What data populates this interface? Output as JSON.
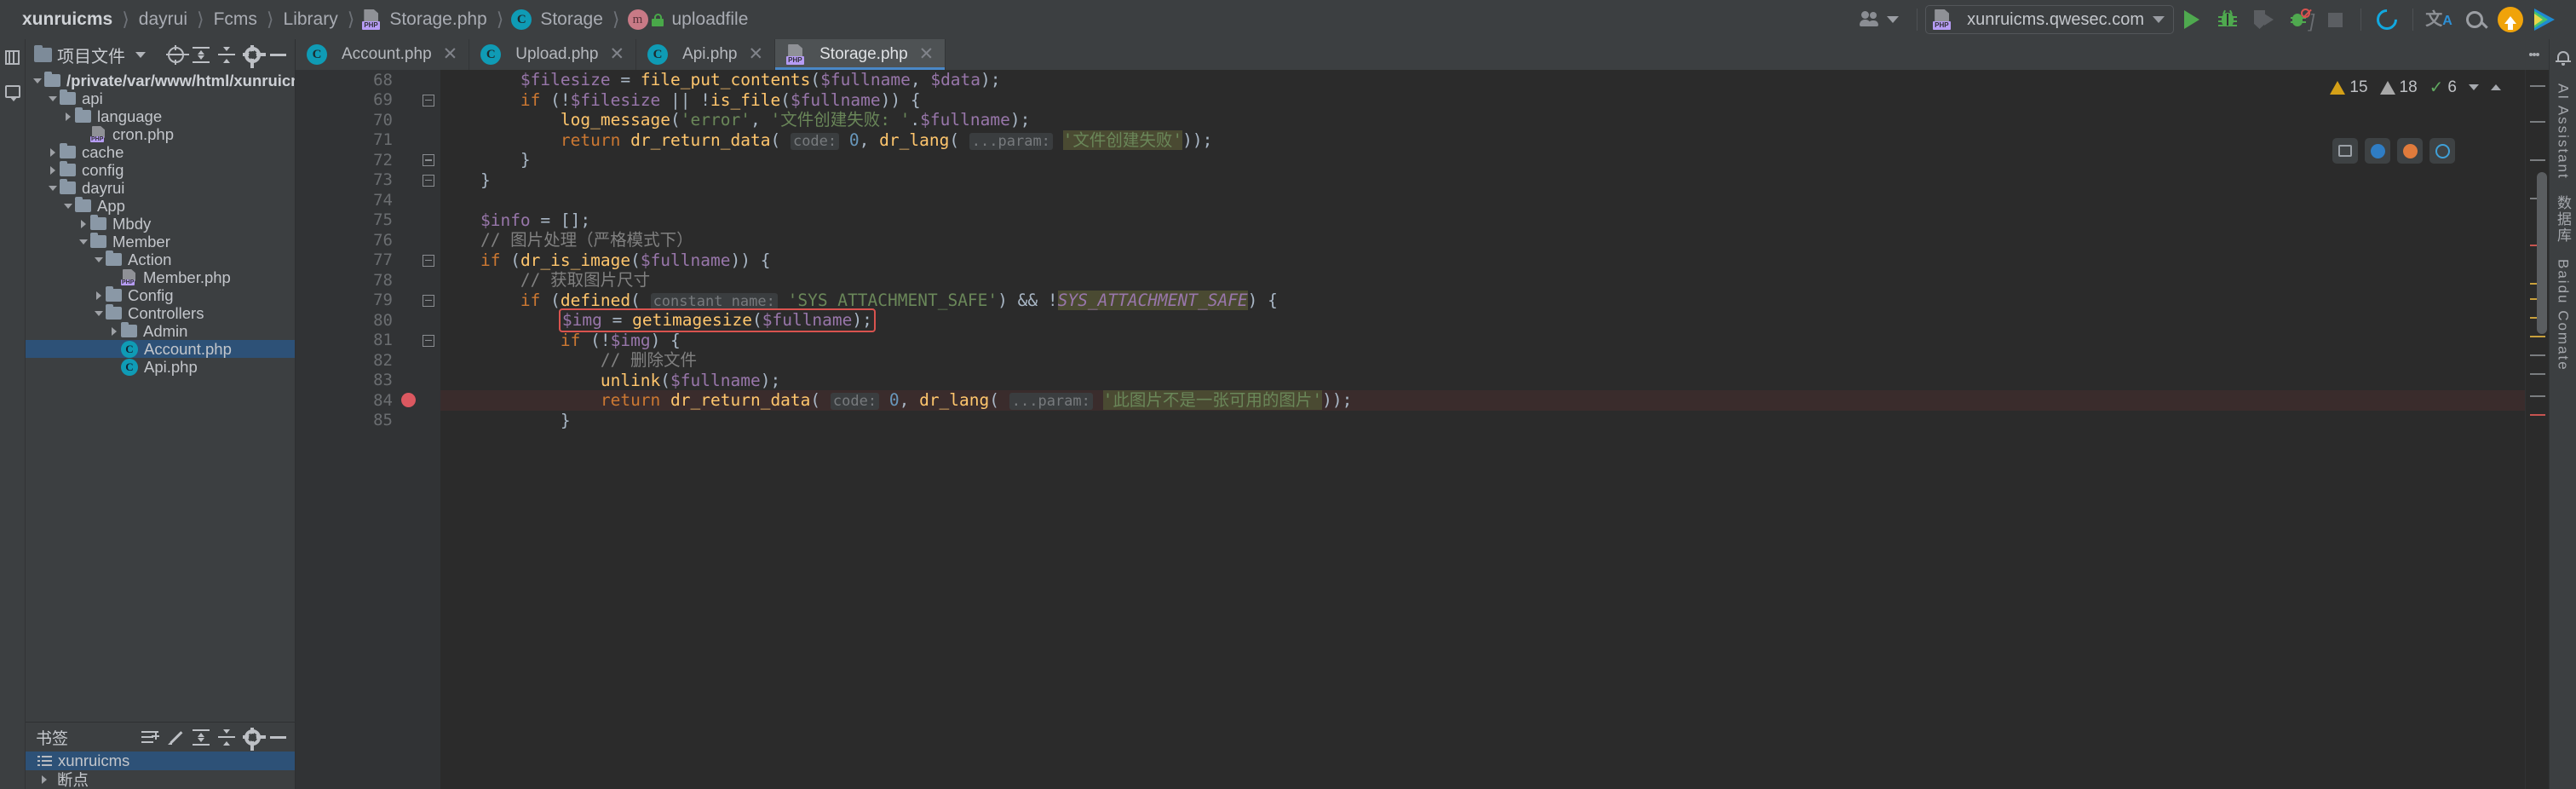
{
  "breadcrumbs": [
    {
      "label": "xunruicms",
      "icon": null,
      "bold": true
    },
    {
      "label": "dayrui",
      "icon": null
    },
    {
      "label": "Fcms",
      "icon": null
    },
    {
      "label": "Library",
      "icon": null
    },
    {
      "label": "Storage.php",
      "icon": "php-file-icon"
    },
    {
      "label": "Storage",
      "icon": "class-icon"
    },
    {
      "label": "uploadfile",
      "icon": "method-icon"
    }
  ],
  "topbar": {
    "run_config": "xunruicms.qwesec.com",
    "icons": [
      "user-avatar-icon",
      "chevron-down-icon",
      "run-icon",
      "debug-icon",
      "coverage-icon",
      "profiler-icon",
      "stop-icon",
      "update-icon",
      "translate-icon",
      "search-everywhere-icon",
      "update-badge-icon",
      "ai-assistant-icon"
    ]
  },
  "left_rail": {
    "items": [
      {
        "name": "project-tool-window",
        "label": "项目"
      },
      {
        "name": "commit-tool-window",
        "label": ""
      }
    ]
  },
  "project_panel": {
    "title": "项目文件",
    "toolbar": [
      "locate-icon",
      "expand-all-icon",
      "collapse-all-icon",
      "settings-icon",
      "hide-icon"
    ],
    "tree": [
      {
        "indent": 0,
        "arrow": "down",
        "icon": "folder",
        "label": "/private/var/www/html/xunruicms",
        "root": true
      },
      {
        "indent": 1,
        "arrow": "down",
        "icon": "folder",
        "label": "api"
      },
      {
        "indent": 2,
        "arrow": "right",
        "icon": "folder",
        "label": "language"
      },
      {
        "indent": 3,
        "arrow": "none",
        "icon": "php",
        "label": "cron.php"
      },
      {
        "indent": 1,
        "arrow": "right",
        "icon": "folder",
        "label": "cache"
      },
      {
        "indent": 1,
        "arrow": "right",
        "icon": "folder",
        "label": "config"
      },
      {
        "indent": 1,
        "arrow": "down",
        "icon": "folder",
        "label": "dayrui"
      },
      {
        "indent": 2,
        "arrow": "down",
        "icon": "folder",
        "label": "App"
      },
      {
        "indent": 3,
        "arrow": "right",
        "icon": "folder",
        "label": "Mbdy"
      },
      {
        "indent": 3,
        "arrow": "down",
        "icon": "folder",
        "label": "Member"
      },
      {
        "indent": 4,
        "arrow": "down",
        "icon": "folder",
        "label": "Action"
      },
      {
        "indent": 5,
        "arrow": "none",
        "icon": "php",
        "label": "Member.php"
      },
      {
        "indent": 4,
        "arrow": "right",
        "icon": "folder",
        "label": "Config"
      },
      {
        "indent": 4,
        "arrow": "down",
        "icon": "folder",
        "label": "Controllers"
      },
      {
        "indent": 5,
        "arrow": "right",
        "icon": "folder",
        "label": "Admin"
      },
      {
        "indent": 5,
        "arrow": "none",
        "icon": "class",
        "label": "Account.php",
        "selected": true
      },
      {
        "indent": 5,
        "arrow": "none",
        "icon": "class",
        "label": "Api.php"
      }
    ]
  },
  "bookmarks": {
    "title": "书签",
    "toolbar": [
      "add-bookmark-icon",
      "edit-icon",
      "expand-all-icon",
      "collapse-all-icon",
      "settings-icon",
      "hide-icon"
    ],
    "items": [
      {
        "label": "xunruicms",
        "icon": "list-icon",
        "selected": true
      },
      {
        "label": "断点",
        "icon": "none",
        "arrow": "right"
      }
    ]
  },
  "tabs": [
    {
      "label": "Account.php",
      "icon": "class-icon",
      "active": false,
      "closable": true
    },
    {
      "label": "Upload.php",
      "icon": "class-icon",
      "active": false,
      "closable": true
    },
    {
      "label": "Api.php",
      "icon": "class-icon",
      "active": false,
      "closable": true
    },
    {
      "label": "Storage.php",
      "icon": "php-file-icon",
      "active": true,
      "closable": true
    }
  ],
  "inspection": {
    "warnings_count": "15",
    "weak_warnings_count": "18",
    "checked_count": "6",
    "warning_icon": "warning-triangle-icon",
    "weak_warning_icon": "weak-warning-triangle-icon",
    "ok_icon": "checkmark-icon"
  },
  "editor": {
    "first_line": 68,
    "lines": [
      {
        "n": 68,
        "fold": null,
        "break": false,
        "hl": false,
        "tokens": [
          {
            "t": "        ",
            "c": "t-def"
          },
          {
            "t": "$filesize",
            "c": "t-var"
          },
          {
            "t": " = ",
            "c": "t-def"
          },
          {
            "t": "file_put_contents",
            "c": "t-fn"
          },
          {
            "t": "(",
            "c": "t-def"
          },
          {
            "t": "$fullname",
            "c": "t-var"
          },
          {
            "t": ", ",
            "c": "t-def"
          },
          {
            "t": "$data",
            "c": "t-var"
          },
          {
            "t": ");",
            "c": "t-def"
          }
        ]
      },
      {
        "n": 69,
        "fold": "minus",
        "break": false,
        "hl": false,
        "tokens": [
          {
            "t": "        ",
            "c": "t-def"
          },
          {
            "t": "if",
            "c": "t-kw"
          },
          {
            "t": " (!",
            "c": "t-def"
          },
          {
            "t": "$filesize",
            "c": "t-var"
          },
          {
            "t": " || !",
            "c": "t-def"
          },
          {
            "t": "is_file",
            "c": "t-fn"
          },
          {
            "t": "(",
            "c": "t-def"
          },
          {
            "t": "$fullname",
            "c": "t-var"
          },
          {
            "t": ")) {",
            "c": "t-def"
          }
        ]
      },
      {
        "n": 70,
        "fold": null,
        "break": false,
        "hl": false,
        "tokens": [
          {
            "t": "            ",
            "c": "t-def"
          },
          {
            "t": "log_message",
            "c": "t-fn"
          },
          {
            "t": "(",
            "c": "t-def"
          },
          {
            "t": "'error'",
            "c": "t-str"
          },
          {
            "t": ", ",
            "c": "t-def"
          },
          {
            "t": "'文件创建失败: '",
            "c": "t-str"
          },
          {
            "t": ".",
            "c": "t-def"
          },
          {
            "t": "$fullname",
            "c": "t-var"
          },
          {
            "t": ");",
            "c": "t-def"
          }
        ]
      },
      {
        "n": 71,
        "fold": null,
        "break": false,
        "hl": false,
        "tokens": [
          {
            "t": "            ",
            "c": "t-def"
          },
          {
            "t": "return",
            "c": "t-kw"
          },
          {
            "t": " ",
            "c": "t-def"
          },
          {
            "t": "dr_return_data",
            "c": "t-fn"
          },
          {
            "t": "( ",
            "c": "t-def"
          },
          {
            "t": "code:",
            "c": "t-hint"
          },
          {
            "t": " ",
            "c": "t-def"
          },
          {
            "t": "0",
            "c": "t-num"
          },
          {
            "t": ", ",
            "c": "t-def"
          },
          {
            "t": "dr_lang",
            "c": "t-fn"
          },
          {
            "t": "( ",
            "c": "t-def"
          },
          {
            "t": "...param:",
            "c": "t-hint"
          },
          {
            "t": " ",
            "c": "t-def"
          },
          {
            "t": "'文件创建失败'",
            "c": "t-hlstr t-str"
          },
          {
            "t": "));",
            "c": "t-def"
          }
        ]
      },
      {
        "n": 72,
        "fold": "minus",
        "break": false,
        "hl": false,
        "tokens": [
          {
            "t": "        }",
            "c": "t-def"
          }
        ]
      },
      {
        "n": 73,
        "fold": "minus",
        "break": false,
        "hl": false,
        "tokens": [
          {
            "t": "    }",
            "c": "t-def"
          }
        ]
      },
      {
        "n": 74,
        "fold": null,
        "break": false,
        "hl": false,
        "tokens": []
      },
      {
        "n": 75,
        "fold": null,
        "break": false,
        "hl": false,
        "tokens": [
          {
            "t": "    ",
            "c": "t-def"
          },
          {
            "t": "$info",
            "c": "t-var"
          },
          {
            "t": " = [];",
            "c": "t-def"
          }
        ]
      },
      {
        "n": 76,
        "fold": null,
        "break": false,
        "hl": false,
        "tokens": [
          {
            "t": "    // 图片处理（严格模式下）",
            "c": "t-cmt"
          }
        ]
      },
      {
        "n": 77,
        "fold": "minus",
        "break": false,
        "hl": false,
        "tokens": [
          {
            "t": "    ",
            "c": "t-def"
          },
          {
            "t": "if",
            "c": "t-kw"
          },
          {
            "t": " (",
            "c": "t-def"
          },
          {
            "t": "dr_is_image",
            "c": "t-fn"
          },
          {
            "t": "(",
            "c": "t-def"
          },
          {
            "t": "$fullname",
            "c": "t-var"
          },
          {
            "t": ")) {",
            "c": "t-def"
          }
        ]
      },
      {
        "n": 78,
        "fold": null,
        "break": false,
        "hl": false,
        "tokens": [
          {
            "t": "        // 获取图片尺寸",
            "c": "t-cmt"
          }
        ]
      },
      {
        "n": 79,
        "fold": "minus",
        "break": false,
        "hl": false,
        "tokens": [
          {
            "t": "        ",
            "c": "t-def"
          },
          {
            "t": "if",
            "c": "t-kw"
          },
          {
            "t": " (",
            "c": "t-def"
          },
          {
            "t": "defined",
            "c": "t-fn"
          },
          {
            "t": "( ",
            "c": "t-def"
          },
          {
            "t": "constant_name:",
            "c": "t-hint"
          },
          {
            "t": " ",
            "c": "t-def"
          },
          {
            "t": "'SYS_ATTACHMENT_SAFE'",
            "c": "t-str"
          },
          {
            "t": ") && !",
            "c": "t-def"
          },
          {
            "t": "SYS_ATTACHMENT_SAFE",
            "c": "t-constbg"
          },
          {
            "t": ") {",
            "c": "t-def"
          }
        ]
      },
      {
        "n": 80,
        "fold": null,
        "break": false,
        "hl": false,
        "boxed": true,
        "tokens": [
          {
            "t": "            ",
            "c": "t-def"
          },
          {
            "t": "$img",
            "c": "t-var"
          },
          {
            "t": " = ",
            "c": "t-def"
          },
          {
            "t": "getimagesize",
            "c": "t-fn"
          },
          {
            "t": "(",
            "c": "t-def"
          },
          {
            "t": "$fullname",
            "c": "t-var"
          },
          {
            "t": ");",
            "c": "t-def"
          }
        ]
      },
      {
        "n": 81,
        "fold": "minus",
        "break": false,
        "hl": false,
        "tokens": [
          {
            "t": "            ",
            "c": "t-def"
          },
          {
            "t": "if",
            "c": "t-kw"
          },
          {
            "t": " (!",
            "c": "t-def"
          },
          {
            "t": "$img",
            "c": "t-var"
          },
          {
            "t": ") {",
            "c": "t-def"
          }
        ]
      },
      {
        "n": 82,
        "fold": null,
        "break": false,
        "hl": false,
        "tokens": [
          {
            "t": "                // 删除文件",
            "c": "t-cmt"
          }
        ]
      },
      {
        "n": 83,
        "fold": null,
        "break": false,
        "hl": false,
        "tokens": [
          {
            "t": "                ",
            "c": "t-def"
          },
          {
            "t": "unlink",
            "c": "t-fn"
          },
          {
            "t": "(",
            "c": "t-def"
          },
          {
            "t": "$fullname",
            "c": "t-var"
          },
          {
            "t": ");",
            "c": "t-def"
          }
        ]
      },
      {
        "n": 84,
        "fold": null,
        "break": true,
        "hl": true,
        "tokens": [
          {
            "t": "                ",
            "c": "t-def"
          },
          {
            "t": "return",
            "c": "t-kw"
          },
          {
            "t": " ",
            "c": "t-def"
          },
          {
            "t": "dr_return_data",
            "c": "t-fn"
          },
          {
            "t": "( ",
            "c": "t-def"
          },
          {
            "t": "code:",
            "c": "t-hint"
          },
          {
            "t": " ",
            "c": "t-def"
          },
          {
            "t": "0",
            "c": "t-num"
          },
          {
            "t": ", ",
            "c": "t-def"
          },
          {
            "t": "dr_lang",
            "c": "t-fn"
          },
          {
            "t": "( ",
            "c": "t-def"
          },
          {
            "t": "...param:",
            "c": "t-hint"
          },
          {
            "t": " ",
            "c": "t-def"
          },
          {
            "t": "'此图片不是一张可用的图片'",
            "c": "t-hlstr t-str"
          },
          {
            "t": "));",
            "c": "t-def"
          }
        ]
      },
      {
        "n": 85,
        "fold": null,
        "break": false,
        "hl": false,
        "tokens": [
          {
            "t": "            }",
            "c": "t-def"
          }
        ]
      }
    ]
  },
  "right_rail": {
    "items": [
      {
        "label": "AI Assistant",
        "name": "ai-assistant-panel"
      },
      {
        "label": "数据库",
        "name": "database-panel"
      },
      {
        "label": "Baidu Comate",
        "name": "baidu-comate-panel"
      }
    ]
  }
}
